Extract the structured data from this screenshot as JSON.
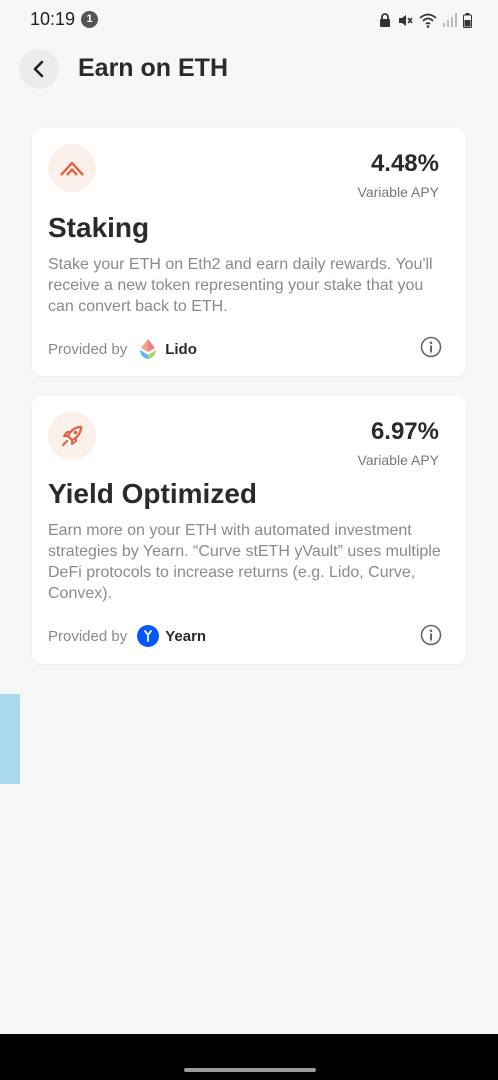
{
  "status_bar": {
    "time": "10:19",
    "notification_count": "1",
    "icons": [
      "lock-icon",
      "mute-icon",
      "wifi-icon",
      "signal-icon",
      "battery-icon"
    ]
  },
  "header": {
    "title": "Earn on ETH",
    "back_icon": "chevron-left-icon"
  },
  "cards": [
    {
      "icon": "staking-chevrons-icon",
      "apy_value": "4.48%",
      "apy_label": "Variable APY",
      "title": "Staking",
      "description": "Stake your ETH on Eth2 and earn daily rewards. You'll receive a new token representing your stake that you can convert back to ETH.",
      "provided_label": "Provided by",
      "provider_name": "Lido",
      "provider_logo": "lido-logo-icon",
      "info_icon": "info-icon"
    },
    {
      "icon": "rocket-icon",
      "apy_value": "6.97%",
      "apy_label": "Variable APY",
      "title": "Yield Optimized",
      "description": "Earn more on your ETH with automated investment strategies by Yearn. “Curve stETH yVault” uses multiple DeFi protocols to increase returns (e.g. Lido, Curve, Convex).",
      "provided_label": "Provided by",
      "provider_name": "Yearn",
      "provider_logo": "yearn-logo-icon",
      "info_icon": "info-icon"
    }
  ],
  "colors": {
    "accent": "#e0603f",
    "accent_bg": "#fbefe9",
    "yearn_blue": "#0657f9",
    "side_tab": "#a9d8ef"
  }
}
